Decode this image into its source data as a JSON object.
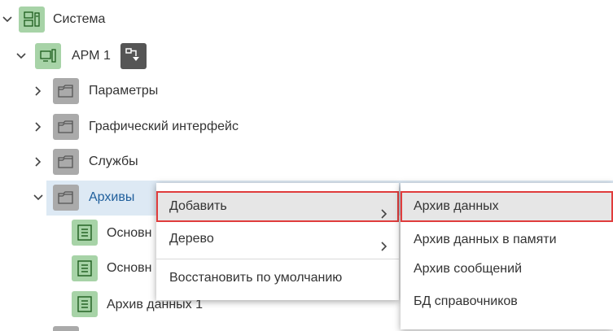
{
  "tree": {
    "root": {
      "label": "Система",
      "icon": "system-icon"
    },
    "workstation": {
      "label": "АРМ 1",
      "icon": "workstation-icon",
      "badge_icon": "deploy-icon"
    },
    "folders": [
      {
        "label": "Параметры",
        "icon": "folder-icon"
      },
      {
        "label": "Графический интерфейс",
        "icon": "folder-icon"
      },
      {
        "label": "Службы",
        "icon": "folder-icon"
      },
      {
        "label": "Архивы",
        "icon": "folder-icon"
      }
    ],
    "archive_children": [
      {
        "label": "Основн",
        "icon": "archive-icon"
      },
      {
        "label": "Основн",
        "icon": "archive-icon"
      },
      {
        "label": "Архив данных 1",
        "icon": "archive-icon"
      }
    ]
  },
  "context_menu": {
    "items": [
      {
        "label": "Добавить",
        "has_submenu": true
      },
      {
        "label": "Дерево",
        "has_submenu": true
      },
      {
        "label": "Восстановить по умолчанию",
        "has_submenu": false
      }
    ]
  },
  "submenu": {
    "items": [
      {
        "label": "Архив данных"
      },
      {
        "label": "Архив данных в памяти"
      },
      {
        "label": "Архив сообщений"
      },
      {
        "label": "БД справочников"
      }
    ]
  },
  "colors": {
    "selection": "#dde9f4",
    "highlight_border": "#e03c3c",
    "green_icon_bg": "#a7d3a7",
    "gray_icon_bg": "#aaaaaa",
    "selected_text": "#1f5f9c"
  }
}
